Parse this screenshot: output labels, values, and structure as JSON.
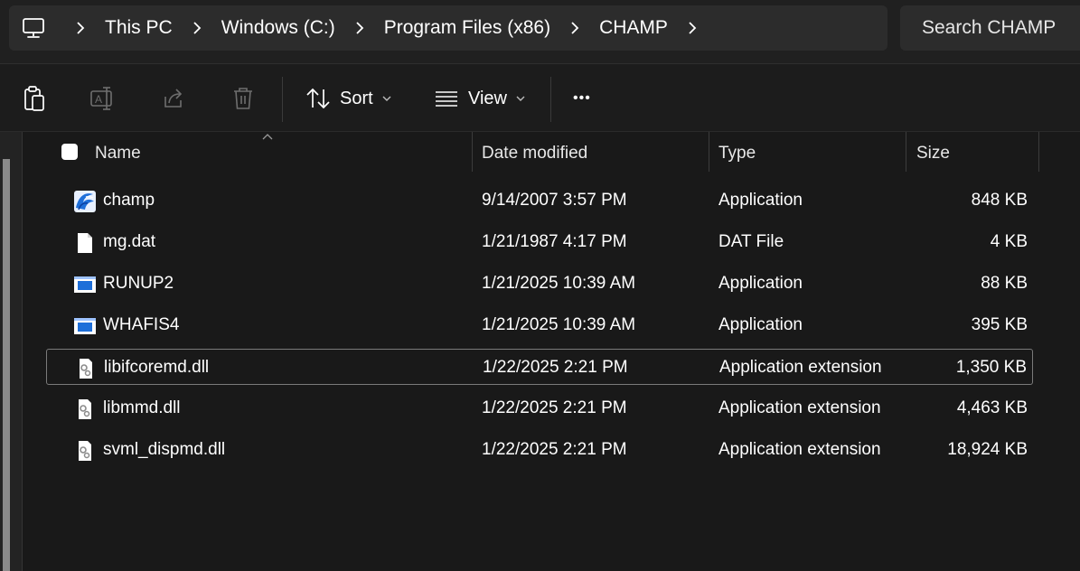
{
  "breadcrumb": {
    "items": [
      "This PC",
      "Windows (C:)",
      "Program Files (x86)",
      "CHAMP"
    ]
  },
  "search": {
    "placeholder": "Search CHAMP"
  },
  "toolbar": {
    "sort_label": "Sort",
    "view_label": "View",
    "more_label": "•••"
  },
  "columns": {
    "name": "Name",
    "date": "Date modified",
    "type": "Type",
    "size": "Size"
  },
  "files": [
    {
      "name": "champ",
      "date": "9/14/2007 3:57 PM",
      "type": "Application",
      "size": "848 KB",
      "icon": "wave-app-icon"
    },
    {
      "name": "mg.dat",
      "date": "1/21/1987 4:17 PM",
      "type": "DAT File",
      "size": "4 KB",
      "icon": "file-icon"
    },
    {
      "name": "RUNUP2",
      "date": "1/21/2025 10:39 AM",
      "type": "Application",
      "size": "88 KB",
      "icon": "app-window-icon"
    },
    {
      "name": "WHAFIS4",
      "date": "1/21/2025 10:39 AM",
      "type": "Application",
      "size": "395 KB",
      "icon": "app-window-icon"
    },
    {
      "name": "libifcoremd.dll",
      "date": "1/22/2025 2:21 PM",
      "type": "Application extension",
      "size": "1,350 KB",
      "icon": "dll-gear-icon"
    },
    {
      "name": "libmmd.dll",
      "date": "1/22/2025 2:21 PM",
      "type": "Application extension",
      "size": "4,463 KB",
      "icon": "dll-gear-icon"
    },
    {
      "name": "svml_dispmd.dll",
      "date": "1/22/2025 2:21 PM",
      "type": "Application extension",
      "size": "18,924 KB",
      "icon": "dll-gear-icon"
    }
  ],
  "selected_row": 4,
  "colors": {
    "background": "#191919",
    "address_bar": "#2c2c2c",
    "text": "#ffffff",
    "app_icon_blue": "#1e6fd9"
  }
}
